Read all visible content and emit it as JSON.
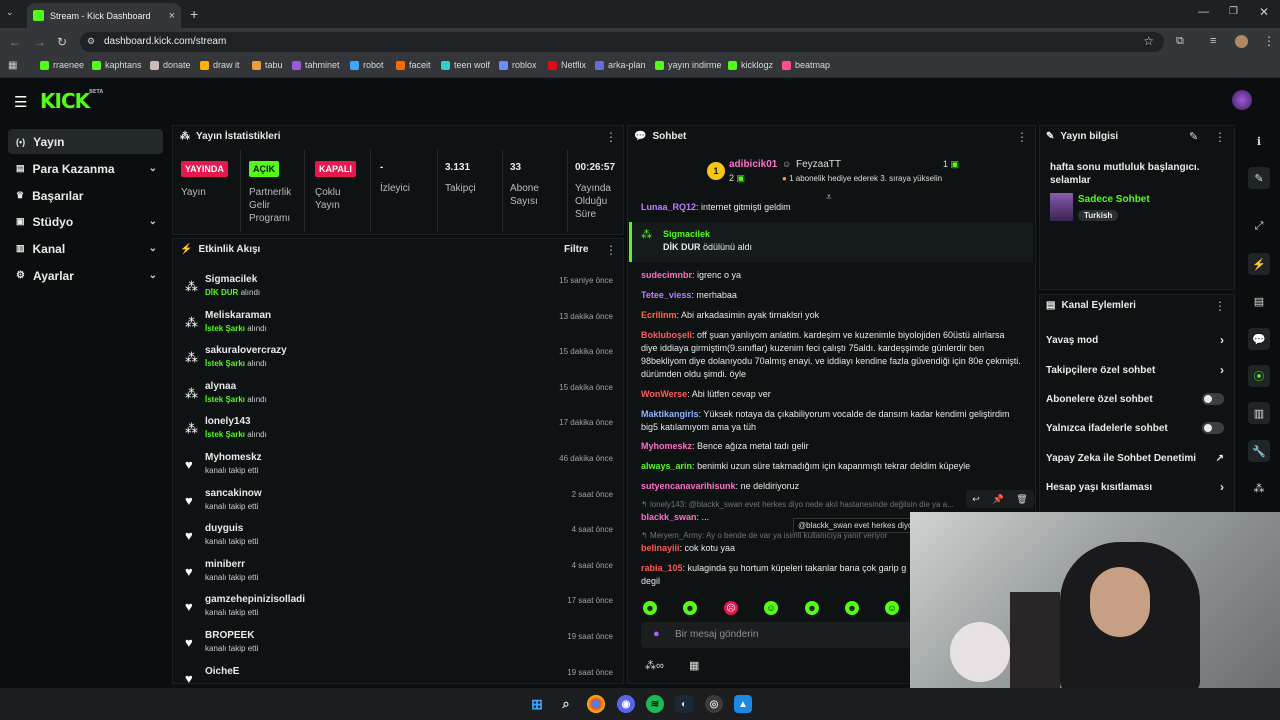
{
  "browser": {
    "tab_title": "Stream - Kick Dashboard",
    "url": "dashboard.kick.com/stream",
    "bookmarks": [
      "rraenee",
      "kaphtans",
      "donate",
      "draw it",
      "tabu",
      "tahminet",
      "robot",
      "faceit",
      "teen wolf",
      "roblox",
      "Netflix",
      "arka-plan",
      "yayın indirme",
      "kicklogz",
      "beatmap"
    ]
  },
  "brand": {
    "logo": "KICK",
    "beta": "BETA",
    "accent": "#53fc18"
  },
  "sidebar": {
    "items": [
      {
        "label": "Yayın"
      },
      {
        "label": "Para Kazanma"
      },
      {
        "label": "Başarılar"
      },
      {
        "label": "Stüdyo"
      },
      {
        "label": "Kanal"
      },
      {
        "label": "Ayarlar"
      }
    ]
  },
  "stats": {
    "title": "Yayın İstatistikleri",
    "cols": [
      {
        "tag": "YAYINDA",
        "label": "Yayın"
      },
      {
        "tag": "AÇIK",
        "label": "Partnerlik Gelir Programı"
      },
      {
        "tag": "KAPALI",
        "label": "Çoklu Yayın"
      },
      {
        "value": "-",
        "label": "İzleyici"
      },
      {
        "value": "3.131",
        "label": "Takipçi"
      },
      {
        "value": "33",
        "label": "Abone Sayısı"
      },
      {
        "value": "00:26:57",
        "label": "Yayında Olduğu Süre"
      }
    ]
  },
  "feed": {
    "title": "Etkinlik Akışı",
    "filter": "Filtre",
    "received": "alındı",
    "items": [
      {
        "name": "Sigmacilek",
        "sub": "DİK DUR",
        "suffix": "alındı",
        "time": "15 saniye önce"
      },
      {
        "name": "Meliskaraman",
        "sub": "İstek Şarkı",
        "suffix": "alındı",
        "time": "13 dakika önce"
      },
      {
        "name": "sakuralovercrazy",
        "sub": "İstek Şarkı",
        "suffix": "alındı",
        "time": "15 dakika önce"
      },
      {
        "name": "alynaa",
        "sub": "İstek Şarkı",
        "suffix": "alındı",
        "time": "15 dakika önce"
      },
      {
        "name": "lonely143",
        "sub": "İstek Şarkı",
        "suffix": "alındı",
        "time": "17 dakika önce"
      },
      {
        "name": "Myhomeskz",
        "sub": "",
        "suffix": "kanalı takip etti",
        "time": "46 dakika önce"
      },
      {
        "name": "sancakinow",
        "sub": "",
        "suffix": "kanalı takip etti",
        "time": "2 saat önce"
      },
      {
        "name": "duyguis",
        "sub": "",
        "suffix": "kanalı takip etti",
        "time": "4 saat önce"
      },
      {
        "name": "miniberr",
        "sub": "",
        "suffix": "kanalı takip etti",
        "time": "4 saat önce"
      },
      {
        "name": "gamzehepinizisolladi",
        "sub": "",
        "suffix": "kanalı takip etti",
        "time": "17 saat önce"
      },
      {
        "name": "BROPEEK",
        "sub": "",
        "suffix": "kanalı takip etti",
        "time": "19 saat önce"
      },
      {
        "name": "OicheE",
        "sub": "",
        "suffix": "",
        "time": "19 saat önce"
      }
    ]
  },
  "chat": {
    "title": "Sohbet",
    "pinned": {
      "rank": "1",
      "user": "adibicik01",
      "count": "2",
      "gifter": "FeyzaaTT",
      "gift_count": "1",
      "gift_text": "1 abonelik hediye ederek 3. sıraya yükselin"
    },
    "reward": {
      "user": "Sigmacilek",
      "text": "DİK DUR",
      "suffix": "ödülünü aldı"
    },
    "messages": [
      {
        "user": "Lunaa_RQ12",
        "color": "#c07cff",
        "text": "internet gitmişti geldim"
      },
      {
        "user": "sudecimnbr",
        "color": "#ff6fc8",
        "text": "igrenc o ya"
      },
      {
        "user": "Tetee_viess",
        "color": "#c07cff",
        "text": "merhabaa"
      },
      {
        "user": "Ecrilinm",
        "color": "#ff6a3d",
        "text": "Abi arkadasimin ayak tirnaklsri yok"
      },
      {
        "user": "Bokluboşeli",
        "color": "#ff5a5a",
        "text": "off şuan yanlıyom anlatim. kardeşim ve kuzenimle biyolojiden 60üstü alırlarsa diye iddiaya girmiştim(9.sınıflar) kuzenim feci çalıştı 75aldı. kardeşşimde günlerdir ben 98bekliyom diye dolanıyodu 70almış enayi. ve iddiayı kendine fazla güvendiği için 80e çekmişti. dürümden oldu şimdi. öyle"
      },
      {
        "user": "WonWerse",
        "color": "#ff5a5a",
        "text": "Abi lütfen cevap ver"
      },
      {
        "user": "Maktikangirls",
        "color": "#8fb3ff",
        "text": "Yüksek notaya da çıkabiliyorum vocalde de dansım kadar kendimi geliştirdim big5 katılamıyom ama ya tüh"
      },
      {
        "user": "Myhomeskz",
        "color": "#ff6fc8",
        "text": "Bence ağıza metal tadı gelir"
      },
      {
        "user": "always_arin",
        "color": "#53fc18",
        "text": "benimki uzun süre takmadığım için kapanmıştı tekrar deldim küpeyle"
      },
      {
        "user": "sutyencanavarihisunk",
        "color": "#ff6fc8",
        "text": "ne deldiriyoruz"
      }
    ],
    "reply1": {
      "text": "lonely143: @blackk_swan evet herkes diyo nede akıl hastanesinde değilsin die ya a...",
      "user": "blackk_swan",
      "msg": "...",
      "tooltip": "@blackk_swan evet herkes diyo"
    },
    "reply2": {
      "text": "Meryem_Army: Ay o bende de var ya isimli kullanıcıya yanıt veriyor",
      "user": "belinayiii",
      "msg": "cok kotu yaa"
    },
    "last": {
      "user": "rabia_105",
      "text": "kulaginda şu hortum küpeleri takanlar bana çok garip g degil"
    },
    "input_placeholder": "Bir mesaj gönderin"
  },
  "stream_info": {
    "title": "Yayın bilgisi",
    "stream_title": "hafta sonu mutluluk başlangıcı. selamlar",
    "category": "Sadece Sohbet",
    "tag": "Turkish"
  },
  "channel_actions": {
    "title": "Kanal Eylemleri",
    "items": [
      {
        "label": "Yavaş mod",
        "ctrl": "arrow"
      },
      {
        "label": "Takipçilere özel sohbet",
        "ctrl": "arrow"
      },
      {
        "label": "Abonelere özel sohbet",
        "ctrl": "toggle"
      },
      {
        "label": "Yalnızca ifadelerle sohbet",
        "ctrl": "toggle"
      },
      {
        "label": "Yapay Zeka ile Sohbet Denetimi",
        "ctrl": "external"
      },
      {
        "label": "Hesap yaşı kısıtlaması",
        "ctrl": "arrow"
      }
    ]
  }
}
